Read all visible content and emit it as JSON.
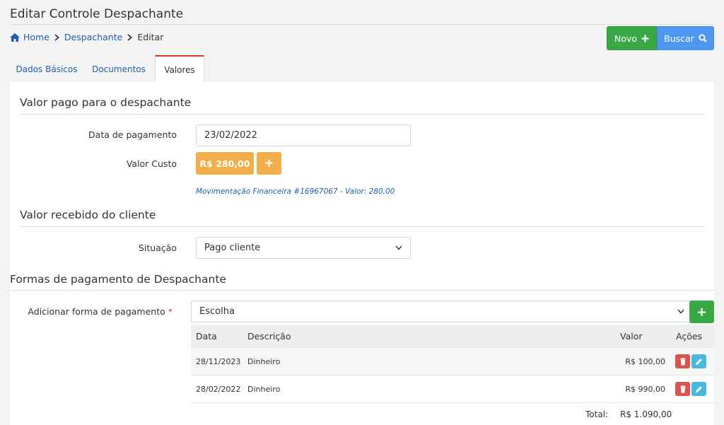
{
  "header": {
    "title": "Editar Controle Despachante"
  },
  "breadcrumb": {
    "home": "Home",
    "despachante": "Despachante",
    "current": "Editar"
  },
  "toolbar": {
    "new_label": "Novo",
    "search_label": "Buscar"
  },
  "tabs": [
    {
      "label": "Dados Básicos"
    },
    {
      "label": "Documentos"
    },
    {
      "label": "Valores"
    }
  ],
  "section_paid": {
    "title": "Valor pago para o despachante",
    "date_label": "Data de pagamento",
    "date_value": "23/02/2022",
    "cost_label": "Valor Custo",
    "cost_value": "R$ 280,00",
    "plus": "+",
    "movement_link": "Movimentação Financeira #16967067 - Valor: 280,00"
  },
  "section_received": {
    "title": "Valor recebido do cliente",
    "status_label": "Situação",
    "status_value": "Pago cliente"
  },
  "section_payments": {
    "title": "Formas de pagamento de Despachante",
    "add_label": "Adicionar forma de pagamento",
    "required_mark": "*",
    "select_value": "Escolha",
    "add_plus": "+",
    "table": {
      "headers": {
        "data": "Data",
        "descricao": "Descrição",
        "valor": "Valor",
        "acoes": "Ações"
      },
      "rows": [
        {
          "data": "28/11/2023",
          "descricao": "Dinheiro",
          "valor": "R$ 100,00"
        },
        {
          "data": "28/02/2022",
          "descricao": "Dinheiro",
          "valor": "R$ 990,00"
        }
      ],
      "total_label": "Total:",
      "total_value": "R$ 1.090,00"
    }
  },
  "colors": {
    "primary_link": "#1f5ea8",
    "success": "#3aa847",
    "info": "#4d97f1",
    "warning": "#f2ae4a",
    "danger": "#d9534f",
    "edit": "#4ab7dd",
    "active_tab_accent": "#d33a2c"
  }
}
